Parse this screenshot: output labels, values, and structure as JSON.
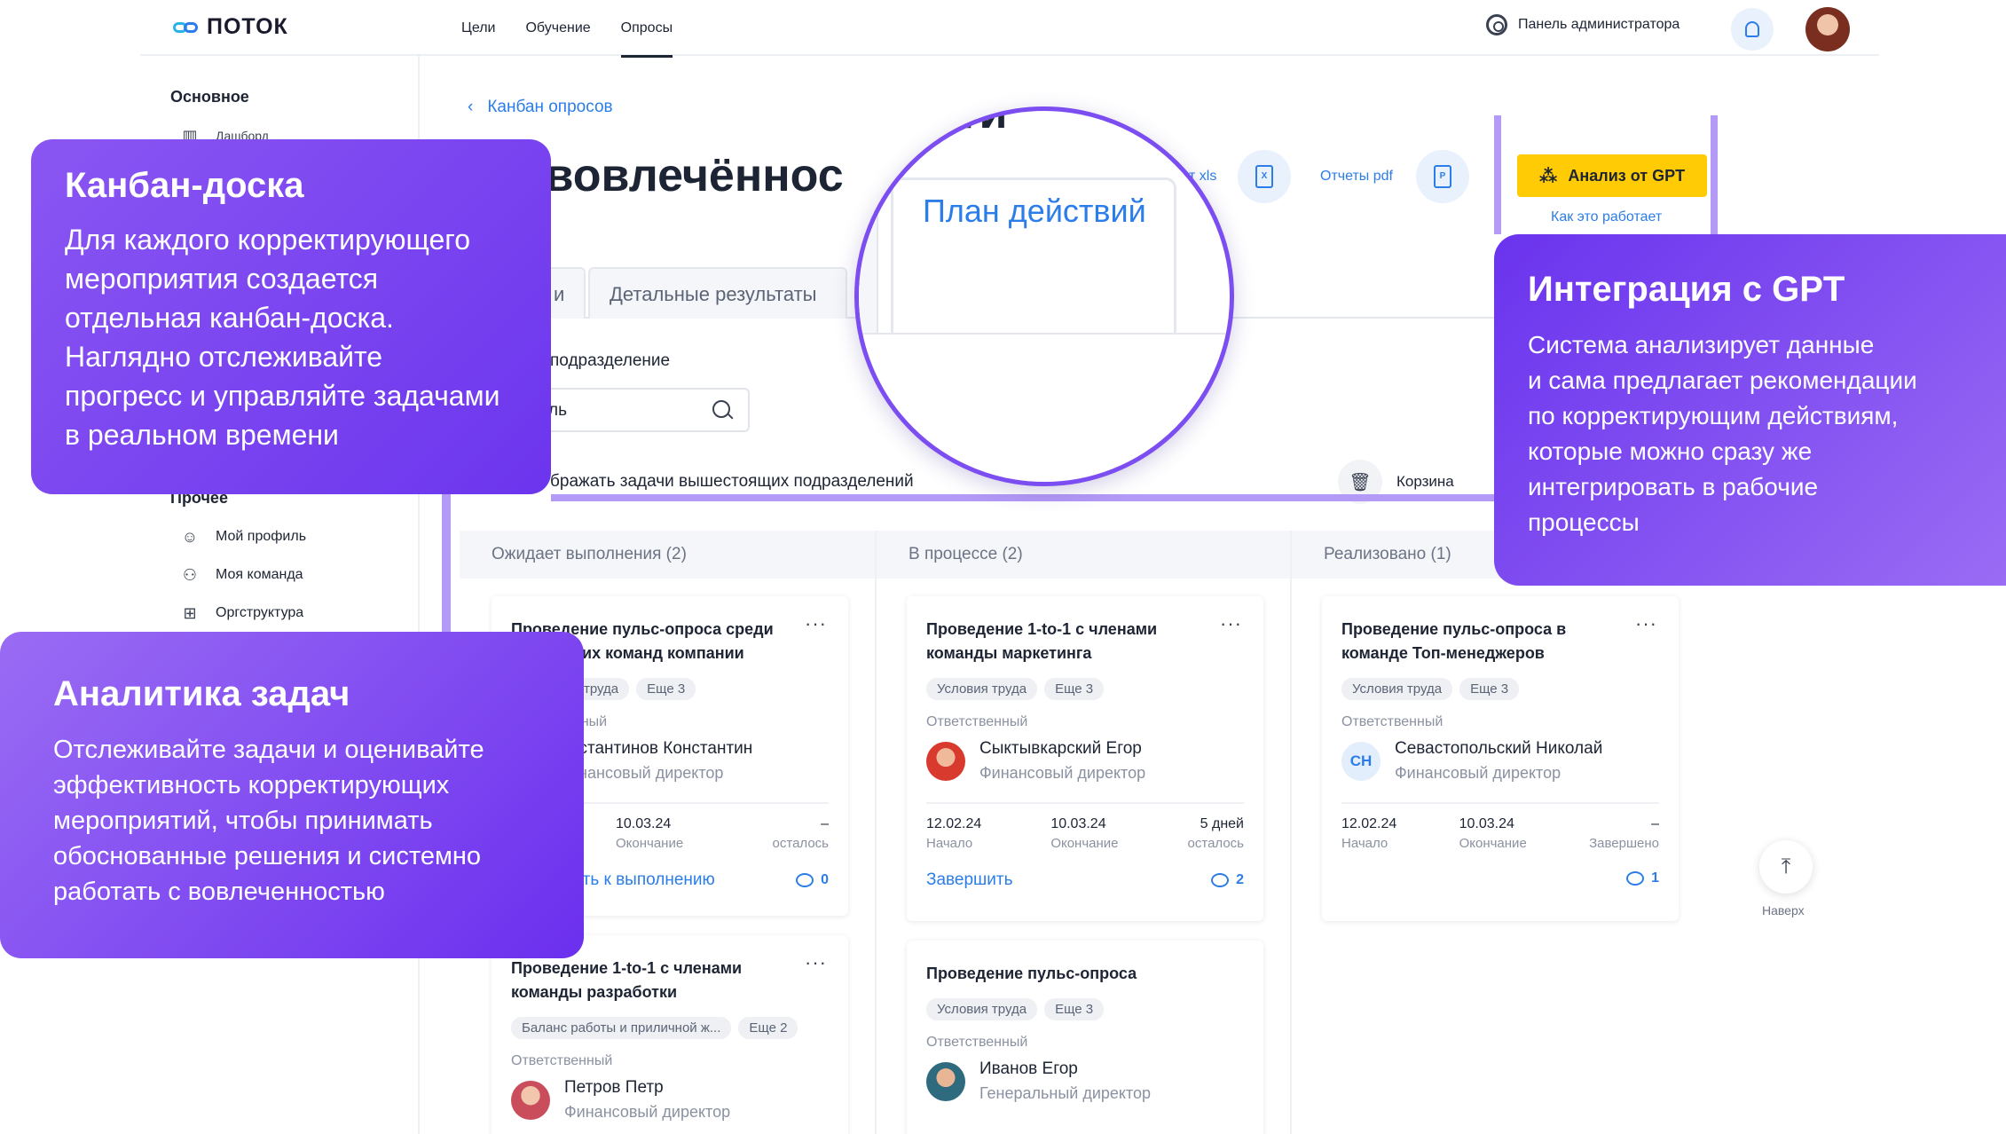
{
  "header": {
    "logo": "ПОТОК",
    "nav": [
      "Цели",
      "Обучение",
      "Опросы"
    ],
    "admin_label": "Панель администратора"
  },
  "sidebar": {
    "section_main": "Основное",
    "dashboard": "Дашборд",
    "section_other": "Прочее",
    "items": [
      "Мой профиль",
      "Моя команда",
      "Оргструктура"
    ]
  },
  "main": {
    "back_label": "Канбан опросов",
    "title_fragment": "ос вовлечённос",
    "export_xls": "т xls",
    "export_pdf": "Отчеты pdf",
    "gpt_button": "Анализ от GPT",
    "gpt_how": "Как это работает",
    "tabs": [
      "и",
      "Детальные результаты"
    ],
    "filter_label": "подразделение",
    "search_value": "ль",
    "checkbox_label": "бражать задачи вышестоящих подразделений",
    "trash_label": "Корзина"
  },
  "magnifier": {
    "title_fragment": "ти",
    "tab_label": "План действий"
  },
  "board": {
    "columns": [
      "Ожидает выполнения (2)",
      "В процессе (2)",
      "Реализовано (1)"
    ],
    "responsible_label": "Ответственный",
    "start_label": "Начало",
    "end_label": "Окончание",
    "cards": [
      {
        "title": "Проведение пульс-опроса среди",
        "title2": "их команд компании",
        "tags": [
          "труда",
          "Еще 3"
        ],
        "resp_label": "нный",
        "name": "нстантинов Константин",
        "role": "инансовый директор",
        "end": "10.03.24",
        "remain": "–",
        "remain_label": "осталось",
        "action": "ить к выполнению",
        "comments": "0"
      },
      {
        "title": "Проведение 1-to-1 с членами",
        "title2": "команды разработки",
        "tags": [
          "Баланс работы и приличной ж...",
          "Еще 2"
        ],
        "name": "Петров Петр",
        "role": "Финансовый директор"
      },
      {
        "title": "Проведение 1-to-1 с членами",
        "title2": "команды маркетинга",
        "tags": [
          "Условия труда",
          "Еще 3"
        ],
        "name": "Сыктывкарский Егор",
        "role": "Финансовый директор",
        "start": "12.02.24",
        "end": "10.03.24",
        "remain": "5 дней",
        "remain_label": "осталось",
        "action": "Завершить",
        "comments": "2"
      },
      {
        "title": "Проведение пульс-опроса",
        "tags": [
          "Условия труда",
          "Еще 3"
        ],
        "name": "Иванов Егор",
        "role": "Генеральный директор"
      },
      {
        "title": "Проведение пульс-опроса в",
        "title2": "команде Топ-менеджеров",
        "tags": [
          "Условия труда",
          "Еще 3"
        ],
        "initials": "СН",
        "name": "Севастопольский Николай",
        "role": "Финансовый директор",
        "start": "12.02.24",
        "end": "10.03.24",
        "remain": "–",
        "remain_label": "Завершено",
        "comments": "1"
      }
    ],
    "to_top": "Наверх"
  },
  "overlays": {
    "kanban": {
      "title": "Канбан-доска",
      "text": "Для каждого корректирующего\nмероприятия создается\nотдельная канбан-доска.\nНаглядно отслеживайте\nпрогресс и управляйте задачами\nв реальном времени"
    },
    "analytics": {
      "title": "Аналитика задач",
      "text": "Отслеживайте задачи и оценивайте\nэффективность корректирующих\nмероприятий, чтобы принимать\nобоснованные решения и системно\nработать с вовлеченностью"
    },
    "gpt": {
      "title": "Интеграция с GPT",
      "text": "Система анализирует данные\nи сама предлагает рекомендации\nпо корректирующим действиям,\nкоторые можно сразу же\nинтегрировать в рабочие\nпроцессы"
    }
  },
  "colors": {
    "accent": "#2b7de9",
    "purple": "#7c4df0",
    "gpt_yellow": "#ffcb05"
  }
}
